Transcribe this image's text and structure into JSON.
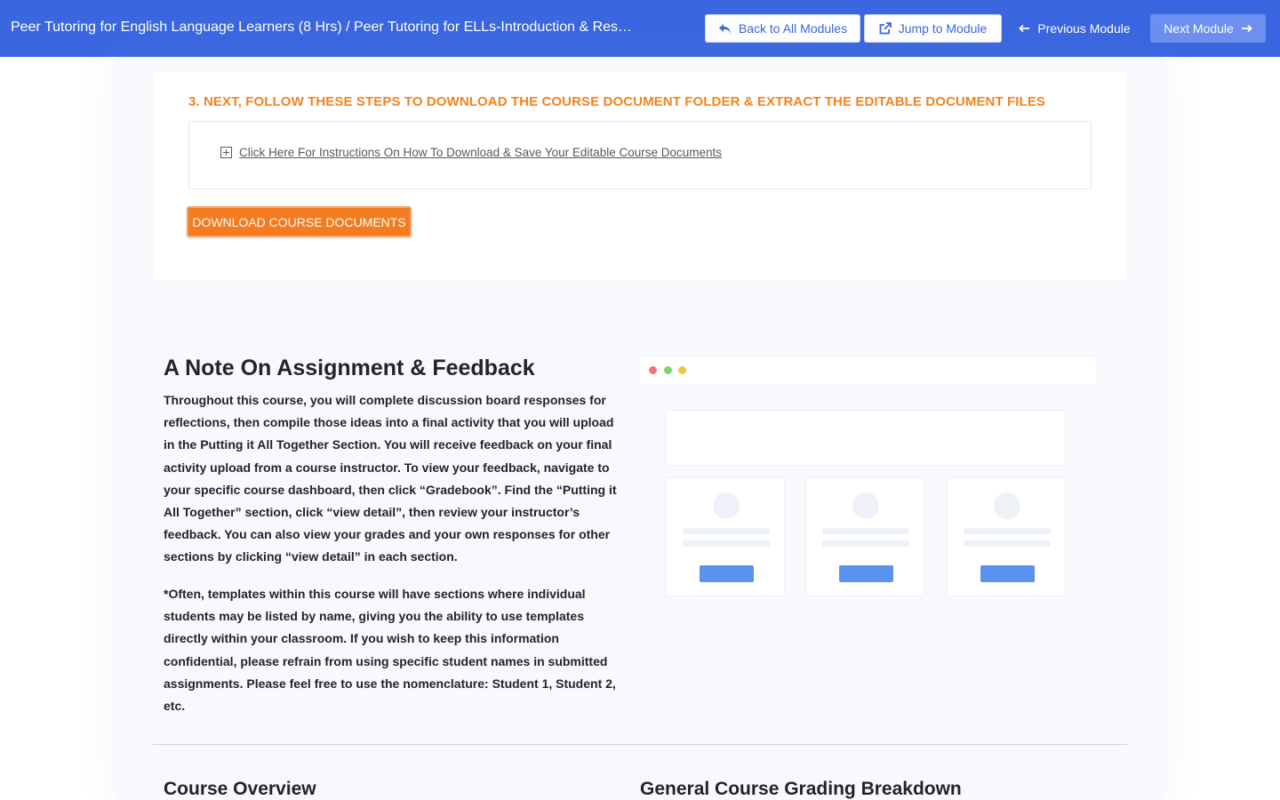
{
  "topbar": {
    "breadcrumb": "Peer Tutoring for English Language Learners (8 Hrs) / Peer Tutoring for ELLs-Introduction & Reso…",
    "back_label": "Back to All Modules",
    "jump_label": "Jump to Module",
    "prev_label": "Previous Module",
    "next_label": "Next Module",
    "icons": [
      "reply-arrow-icon",
      "external-link-icon",
      "arrow-left-icon",
      "arrow-right-icon"
    ]
  },
  "download_section": {
    "heading": "3. NEXT, FOLLOW THESE STEPS TO DOWNLOAD THE COURSE DOCUMENT FOLDER & EXTRACT THE EDITABLE DOCUMENT FILES",
    "accordion_label": "Click Here For Instructions On How To Download & Save Your Editable Course Documents",
    "download_button": "DOWNLOAD COURSE DOCUMENTS"
  },
  "note": {
    "title": "A Note On Assignment & Feedback",
    "paragraph1": "Throughout this course, you will complete discussion board responses for reflections, then compile those ideas into a final activity that you will upload in the Putting it All Together Section. You will receive feedback on your final activity upload from a course instructor. To view your feedback, navigate to your specific course dashboard, then click “Gradebook”. Find the “Putting it All Together” section, click “view detail”, then review your instructor’s feedback. You can also view your grades and your own responses for other sections by clicking “view detail” in each section.",
    "paragraph2": "*Often, templates within this course will have sections where individual students may be listed by name, giving you the ability to use templates directly within your classroom.  If you wish to keep this information confidential, please refrain from using specific student names in submitted assignments.  Please feel free to use the nomenclature: Student 1, Student 2, etc."
  },
  "illustration": {
    "dot_colors": [
      "#f4736e",
      "#7ed36b",
      "#f4c14a"
    ],
    "button_color": "#5a92f0"
  },
  "bottom": {
    "overview_title": "Course Overview",
    "grading_title": "General Course Grading Breakdown"
  },
  "colors": {
    "topbar": "#3a67e0",
    "accent_orange": "#f47b20",
    "heading_orange": "#f5821f"
  }
}
